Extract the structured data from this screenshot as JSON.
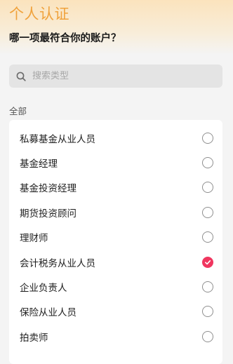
{
  "header": {
    "title": "个人认证",
    "subtitle": "哪一项最符合你的账户？"
  },
  "search": {
    "placeholder": "搜索类型",
    "icon": "search-icon"
  },
  "section": {
    "label": "全部"
  },
  "colors": {
    "accent_title": "#f0a23c",
    "selected_radio": "#f0365f"
  },
  "options": [
    {
      "label": "私募基金从业人员",
      "selected": false
    },
    {
      "label": "基金经理",
      "selected": false
    },
    {
      "label": "基金投资经理",
      "selected": false
    },
    {
      "label": "期货投资顾问",
      "selected": false
    },
    {
      "label": "理财师",
      "selected": false
    },
    {
      "label": "会计税务从业人员",
      "selected": true
    },
    {
      "label": "企业负责人",
      "selected": false
    },
    {
      "label": "保险从业人员",
      "selected": false
    },
    {
      "label": "拍卖师",
      "selected": false
    }
  ]
}
